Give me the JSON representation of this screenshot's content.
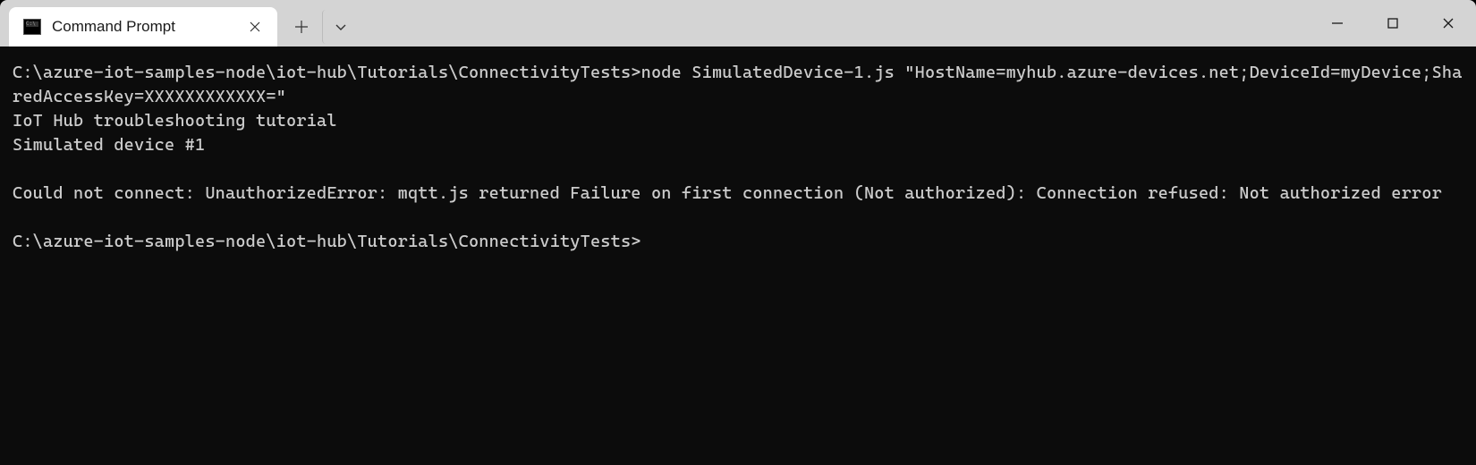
{
  "tab": {
    "title": "Command Prompt"
  },
  "terminal": {
    "lines": [
      "C:\\azure-iot-samples-node\\iot-hub\\Tutorials\\ConnectivityTests>node SimulatedDevice-1.js \"HostName=myhub.azure-devices.net;DeviceId=myDevice;SharedAccessKey=XXXXXXXXXXXX=\"",
      "IoT Hub troubleshooting tutorial",
      "Simulated device #1",
      "",
      "Could not connect: UnauthorizedError: mqtt.js returned Failure on first connection (Not authorized): Connection refused: Not authorized error",
      "",
      "C:\\azure-iot-samples-node\\iot-hub\\Tutorials\\ConnectivityTests>"
    ]
  }
}
